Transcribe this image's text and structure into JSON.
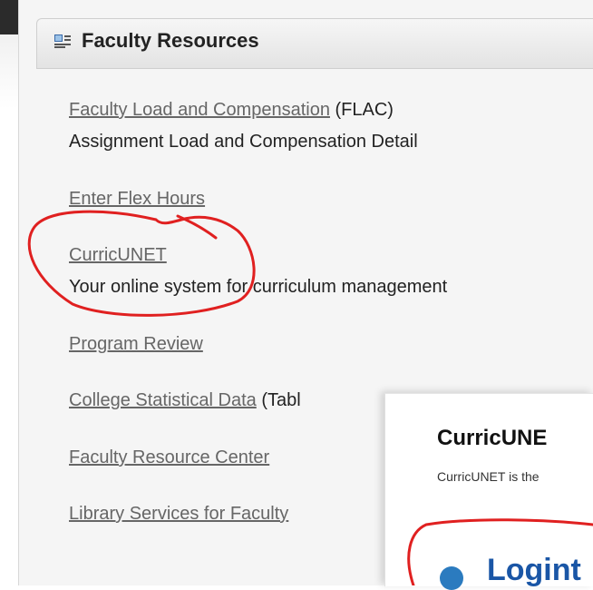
{
  "panel": {
    "title": "Faculty Resources",
    "items": [
      {
        "link": "Faculty Load and Compensation",
        "suffix": " (FLAC)",
        "desc": "Assignment Load and Compensation Detail"
      },
      {
        "link": "Enter Flex Hours"
      },
      {
        "link": "CurricUNET",
        "desc": "Your online system for curriculum management"
      },
      {
        "link": "Program Review"
      },
      {
        "link": "College Statistical Data",
        "suffix": " (Tabl"
      },
      {
        "link": "Faculty Resource Center"
      },
      {
        "link": "Library Services for Faculty"
      }
    ]
  },
  "popup": {
    "title": "CurricUNE",
    "text": "CurricUNET is the",
    "link_partial": "Logint"
  },
  "colors": {
    "link": "#666666",
    "annotation": "#e02020",
    "header_bg": "#e8e8e8"
  },
  "icons": [
    "list-icon"
  ]
}
